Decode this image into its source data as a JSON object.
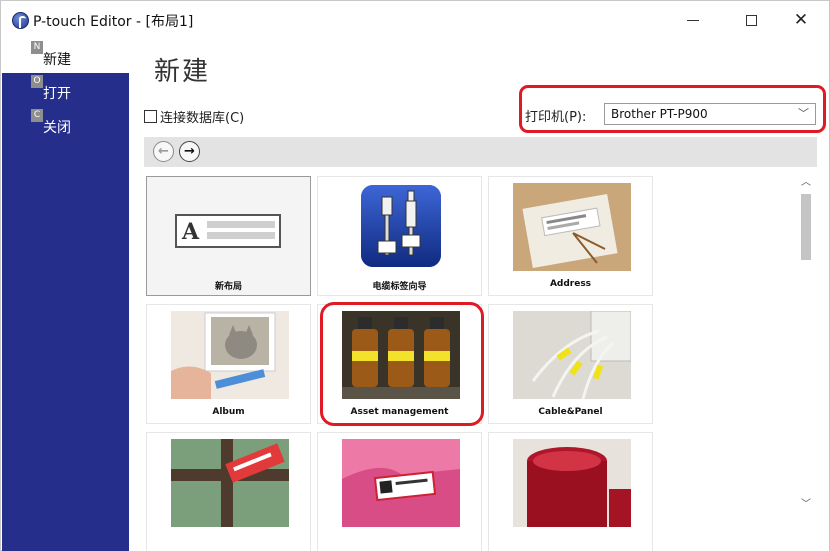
{
  "window": {
    "title": "P-touch Editor - [布局1]"
  },
  "sidebar": {
    "items": [
      {
        "key": "N",
        "label": "新建",
        "active": true
      },
      {
        "key": "O",
        "label": "打开",
        "active": false
      },
      {
        "key": "C",
        "label": "关闭",
        "active": false
      }
    ]
  },
  "main": {
    "title": "新建",
    "database_checkbox": {
      "label": "连接数据库(C)",
      "checked": false
    },
    "printer": {
      "label": "打印机(P):",
      "value": "Brother PT-P900"
    },
    "templates": [
      {
        "caption": "新布局",
        "icon": "new-layout"
      },
      {
        "caption": "电缆标签向导",
        "icon": "cable-wizard"
      },
      {
        "caption": "Address",
        "icon": "address-photo"
      },
      {
        "caption": "Album",
        "icon": "album-photo"
      },
      {
        "caption": "Asset management",
        "icon": "asset-photo"
      },
      {
        "caption": "Cable&Panel",
        "icon": "cable-panel-photo"
      },
      {
        "caption": "",
        "icon": "gift-tag-photo"
      },
      {
        "caption": "",
        "icon": "name-badge-photo"
      },
      {
        "caption": "",
        "icon": "jam-jar-photo"
      }
    ]
  },
  "colors": {
    "sidebar": "#252e8b",
    "highlight": "#e01a24"
  }
}
